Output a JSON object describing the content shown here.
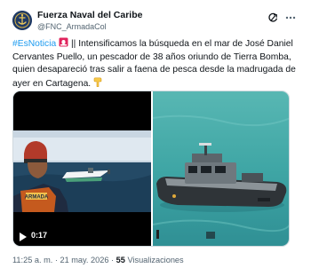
{
  "author": {
    "display_name": "Fuerza Naval del Caribe",
    "handle": "@FNC_ArmadaCol",
    "avatar_icon": "naval-crest-icon"
  },
  "header_icons": {
    "grok": "grok-refresh-icon",
    "more": "more-options-icon"
  },
  "tweet": {
    "hashtag": "#EsNoticia",
    "emoji_siren": "police-siren-icon",
    "separator": "||",
    "body": "Intensificamos la búsqueda en el mar de José Daniel Cervantes Puello, un pescador de 38 años oriundo de Tierra Bomba, quien desapareció tras salir a faena de pesca desde la madrugada de ayer en Cartagena.",
    "emoji_end": "backhand-pointing-down-icon"
  },
  "media": {
    "video_duration": "0:17",
    "video_badge_icon": "play-icon",
    "helmet_text": "ARMADA"
  },
  "meta": {
    "time": "11:25 a. m.",
    "dot": "·",
    "date": "21 may. 2026",
    "views_count": "55",
    "views_label": "Visualizaciones"
  },
  "colors": {
    "link": "#1d9bf0",
    "secondary_text": "#536471",
    "primary_text": "#0f1419",
    "sea_teal": "#3fa6a5"
  }
}
